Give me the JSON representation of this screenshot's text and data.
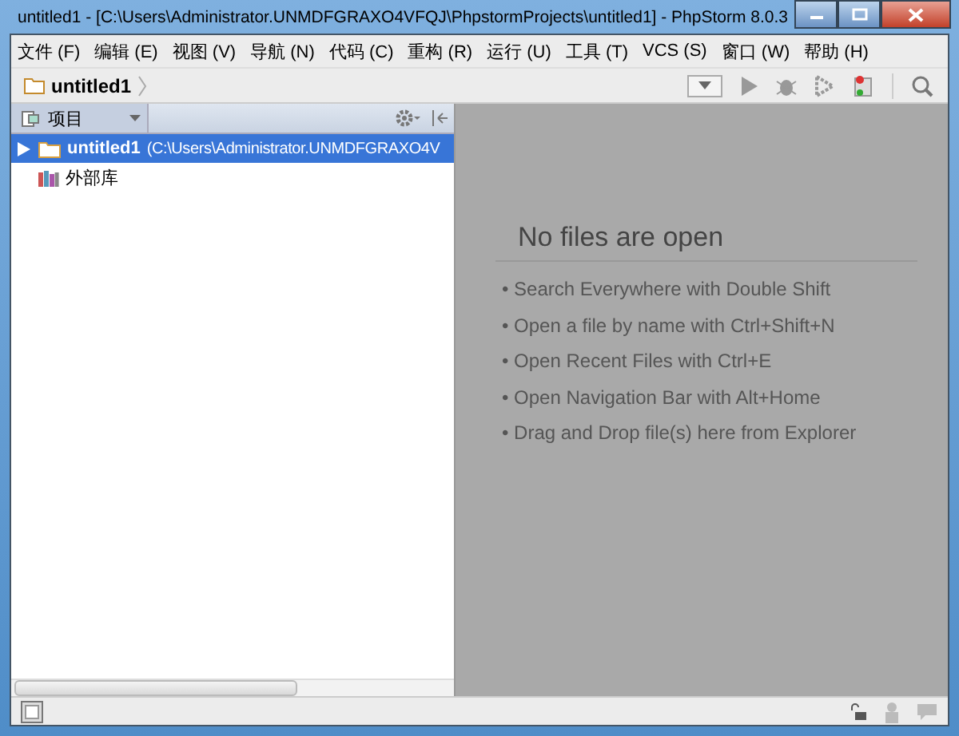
{
  "window": {
    "title": "untitled1 - [C:\\Users\\Administrator.UNMDFGRAXO4VFQJ\\PhpstormProjects\\untitled1] - PhpStorm 8.0.3"
  },
  "menu": [
    "文件 (F)",
    "编辑 (E)",
    "视图 (V)",
    "导航 (N)",
    "代码 (C)",
    "重构 (R)",
    "运行 (U)",
    "工具 (T)",
    "VCS (S)",
    "窗口 (W)",
    "帮助 (H)"
  ],
  "breadcrumb": "untitled1",
  "project_panel": {
    "title": "项目",
    "tree": [
      {
        "name": "untitled1",
        "path": "(C:\\Users\\Administrator.UNMDFGRAXO4V",
        "kind": "folder",
        "selected": true,
        "expanded": false
      },
      {
        "name": "外部库",
        "kind": "library",
        "selected": false
      }
    ]
  },
  "editor": {
    "heading": "No files are open",
    "hints": [
      "• Search Everywhere with Double Shift",
      "• Open a file by name with Ctrl+Shift+N",
      "• Open Recent Files with Ctrl+E",
      "• Open Navigation Bar with Alt+Home",
      "• Drag and Drop file(s) here from Explorer"
    ]
  }
}
